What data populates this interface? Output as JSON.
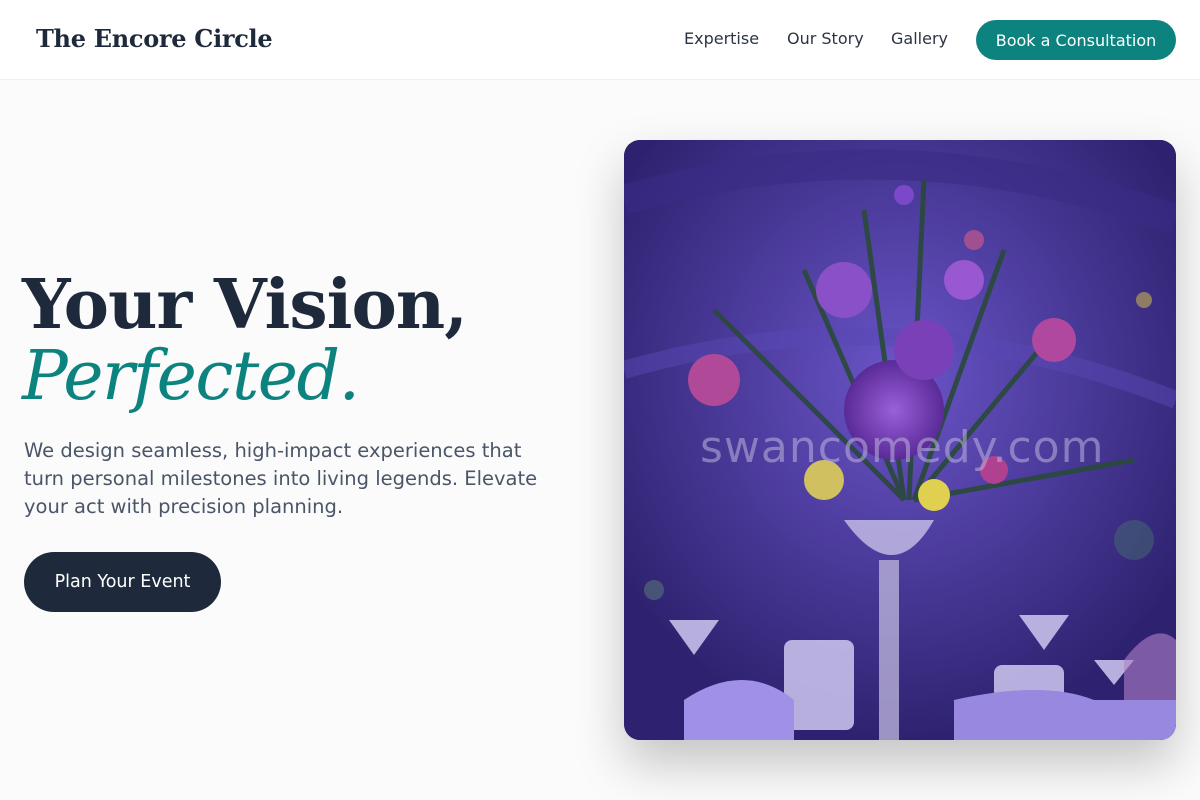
{
  "header": {
    "brand": "The Encore Circle",
    "nav": {
      "expertise": "Expertise",
      "story": "Our Story",
      "gallery": "Gallery"
    },
    "cta": "Book a Consultation"
  },
  "hero": {
    "title_line1": "Your Vision,",
    "title_line2": "Perfected.",
    "description": "We design seamless, high-impact experiences that turn personal milestones into living legends. Elevate your act with precision planning.",
    "cta": "Plan Your Event",
    "image": {
      "subject": "purple floral centerpiece on banquet table",
      "watermark": "swancomedy.com"
    }
  },
  "colors": {
    "accent": "#0d8380",
    "dark": "#1e2a3b",
    "background": "#fbfbfb",
    "body_text": "#4a5568"
  }
}
